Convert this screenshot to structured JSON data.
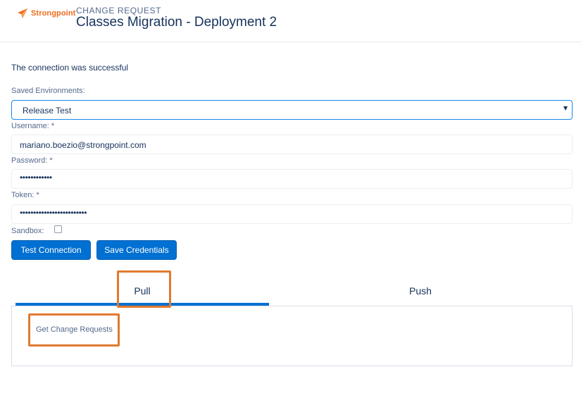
{
  "header": {
    "logo_text": "Strongpoint",
    "eyebrow": "CHANGE REQUEST",
    "title": "Classes Migration - Deployment 2"
  },
  "status_message": "The connection was successful",
  "form": {
    "saved_environments_label": "Saved Environments:",
    "saved_environments_value": "Release Test",
    "username_label": "Username: *",
    "username_value": "mariano.boezio@strongpoint.com",
    "password_label": "Password: *",
    "password_value": "••••••••••••",
    "token_label": "Token: *",
    "token_value": "•••••••••••••••••••••••••",
    "sandbox_label": "Sandbox:",
    "sandbox_checked": false
  },
  "buttons": {
    "test_connection": "Test Connection",
    "save_credentials": "Save Credentials"
  },
  "tabs": [
    {
      "label": "Pull",
      "active": true
    },
    {
      "label": "Push",
      "active": false
    }
  ],
  "panel": {
    "link_label": "Get Change Requests"
  },
  "colors": {
    "brand_orange": "#ec6b1e",
    "primary_blue": "#0070d2",
    "highlight_orange": "#e07a2f",
    "text_dark": "#16325c",
    "text_muted": "#54698d"
  },
  "icons": {
    "logo": "strongpoint-logo-icon",
    "dropdown": "chevron-down-icon"
  }
}
